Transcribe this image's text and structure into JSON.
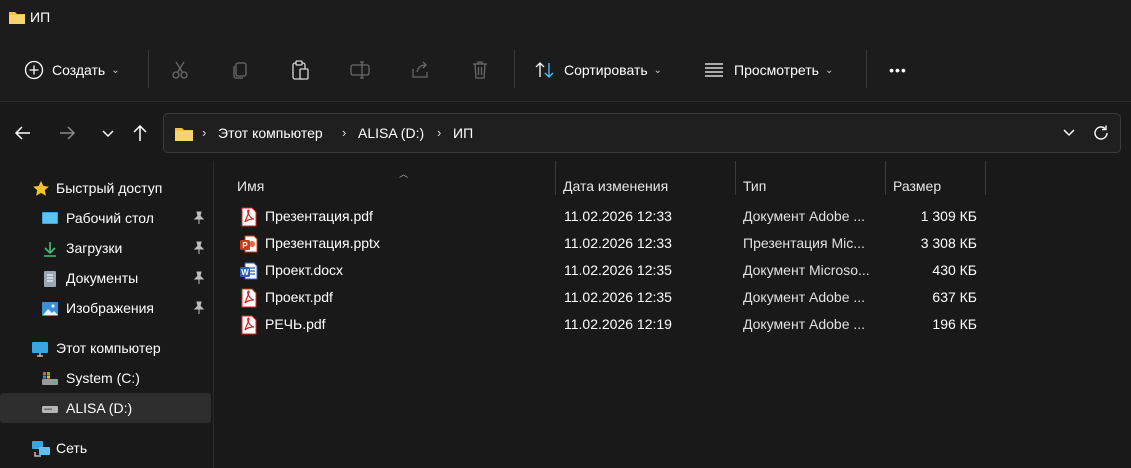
{
  "window": {
    "title": "ИП"
  },
  "toolbar": {
    "new_label": "Создать",
    "sort_label": "Сортировать",
    "view_label": "Просмотреть",
    "more_label": "•••"
  },
  "address": {
    "crumbs": [
      "Этот компьютер",
      "ALISA (D:)",
      "ИП"
    ]
  },
  "sidebar": {
    "quick_access": "Быстрый доступ",
    "items": [
      {
        "label": "Рабочий стол",
        "icon": "desktop-icon",
        "pinned": true
      },
      {
        "label": "Загрузки",
        "icon": "download-icon",
        "pinned": true
      },
      {
        "label": "Документы",
        "icon": "documents-icon",
        "pinned": true
      },
      {
        "label": "Изображения",
        "icon": "pictures-icon",
        "pinned": true
      }
    ],
    "this_pc": "Этот компьютер",
    "drives": [
      {
        "label": "System (C:)",
        "icon": "system-drive-icon"
      },
      {
        "label": "ALISA (D:)",
        "icon": "drive-icon",
        "selected": true
      }
    ],
    "network": "Сеть"
  },
  "columns": {
    "name": "Имя",
    "date": "Дата изменения",
    "type": "Тип",
    "size": "Размер"
  },
  "files": [
    {
      "name": "Презентация.pdf",
      "date": "11.02.2026 12:33",
      "type": "Документ Adobe ...",
      "size": "1 309 КБ",
      "icon": "pdf-icon"
    },
    {
      "name": "Презентация.pptx",
      "date": "11.02.2026 12:33",
      "type": "Презентация Mic...",
      "size": "3 308 КБ",
      "icon": "pptx-icon"
    },
    {
      "name": "Проект.docx",
      "date": "11.02.2026 12:35",
      "type": "Документ Microso...",
      "size": "430 КБ",
      "icon": "docx-icon"
    },
    {
      "name": "Проект.pdf",
      "date": "11.02.2026 12:35",
      "type": "Документ Adobe ...",
      "size": "637 КБ",
      "icon": "pdf-icon"
    },
    {
      "name": "РЕЧЬ.pdf",
      "date": "11.02.2026 12:19",
      "type": "Документ Adobe ...",
      "size": "196 КБ",
      "icon": "pdf-icon"
    }
  ],
  "colors": {
    "background": "#191919",
    "folder": "#f2c14e",
    "pdf": "#d9261c",
    "pptx": "#c43e1c",
    "docx": "#2b5fb4",
    "star": "#f4c430",
    "accent": "#4cc2ff"
  }
}
